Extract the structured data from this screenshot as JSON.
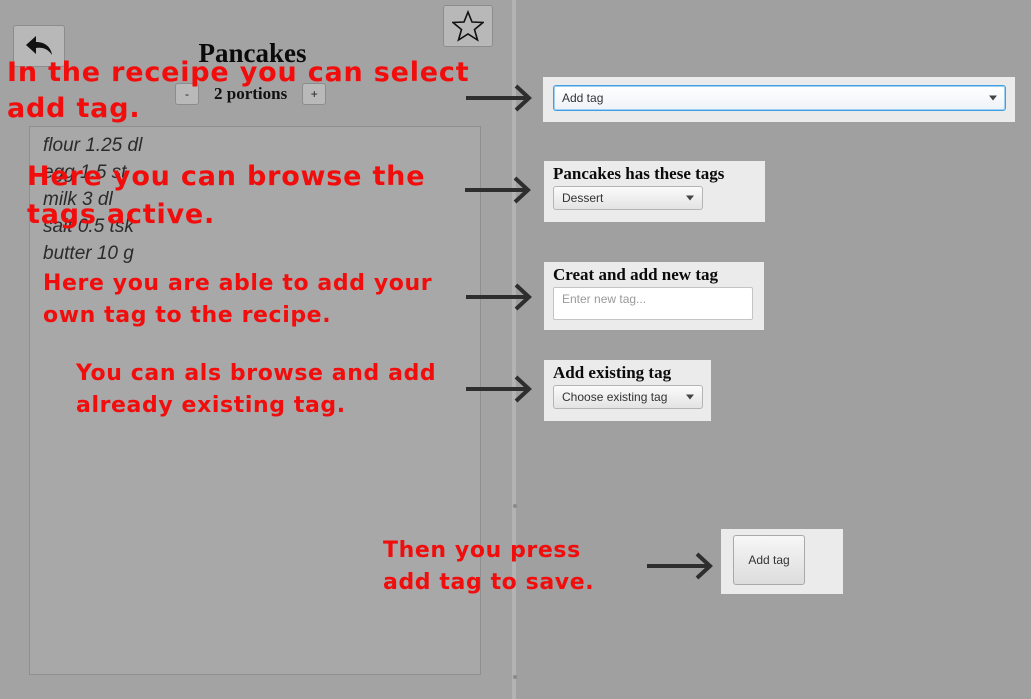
{
  "recipe": {
    "title": "Pancakes",
    "portions_label": "2 portions",
    "minus_label": "-",
    "plus_label": "+",
    "ingredients": [
      "flour 1.25 dl",
      "egg 1.5 st",
      "milk 3 dl",
      "salt 0.5 tsk",
      "butter 10 g"
    ]
  },
  "icons": {
    "back": "back-arrow-icon",
    "favorite": "star-icon"
  },
  "annotations": {
    "select_add_tag": [
      "In the receipe you can select",
      "add tag."
    ],
    "browse_active": [
      "Here you can browse the",
      "tags active."
    ],
    "add_own": [
      "Here you are able to add your",
      "own tag to the recipe."
    ],
    "browse_existing": [
      "You can als browse and add",
      "already existing tag."
    ],
    "press_save": [
      "Then you press",
      "add tag to save."
    ]
  },
  "tag_panel": {
    "add_tag_combo": "Add tag",
    "active_tags_heading": "Pancakes has these tags",
    "active_tags_value": "Dessert",
    "new_tag_heading": "Creat and add new tag",
    "new_tag_placeholder": "Enter new tag...",
    "existing_heading": "Add existing tag",
    "existing_combo": "Choose existing tag",
    "save_button": "Add tag"
  },
  "colors": {
    "annotation": "#f20d0d",
    "focus": "#3f9fe3"
  }
}
